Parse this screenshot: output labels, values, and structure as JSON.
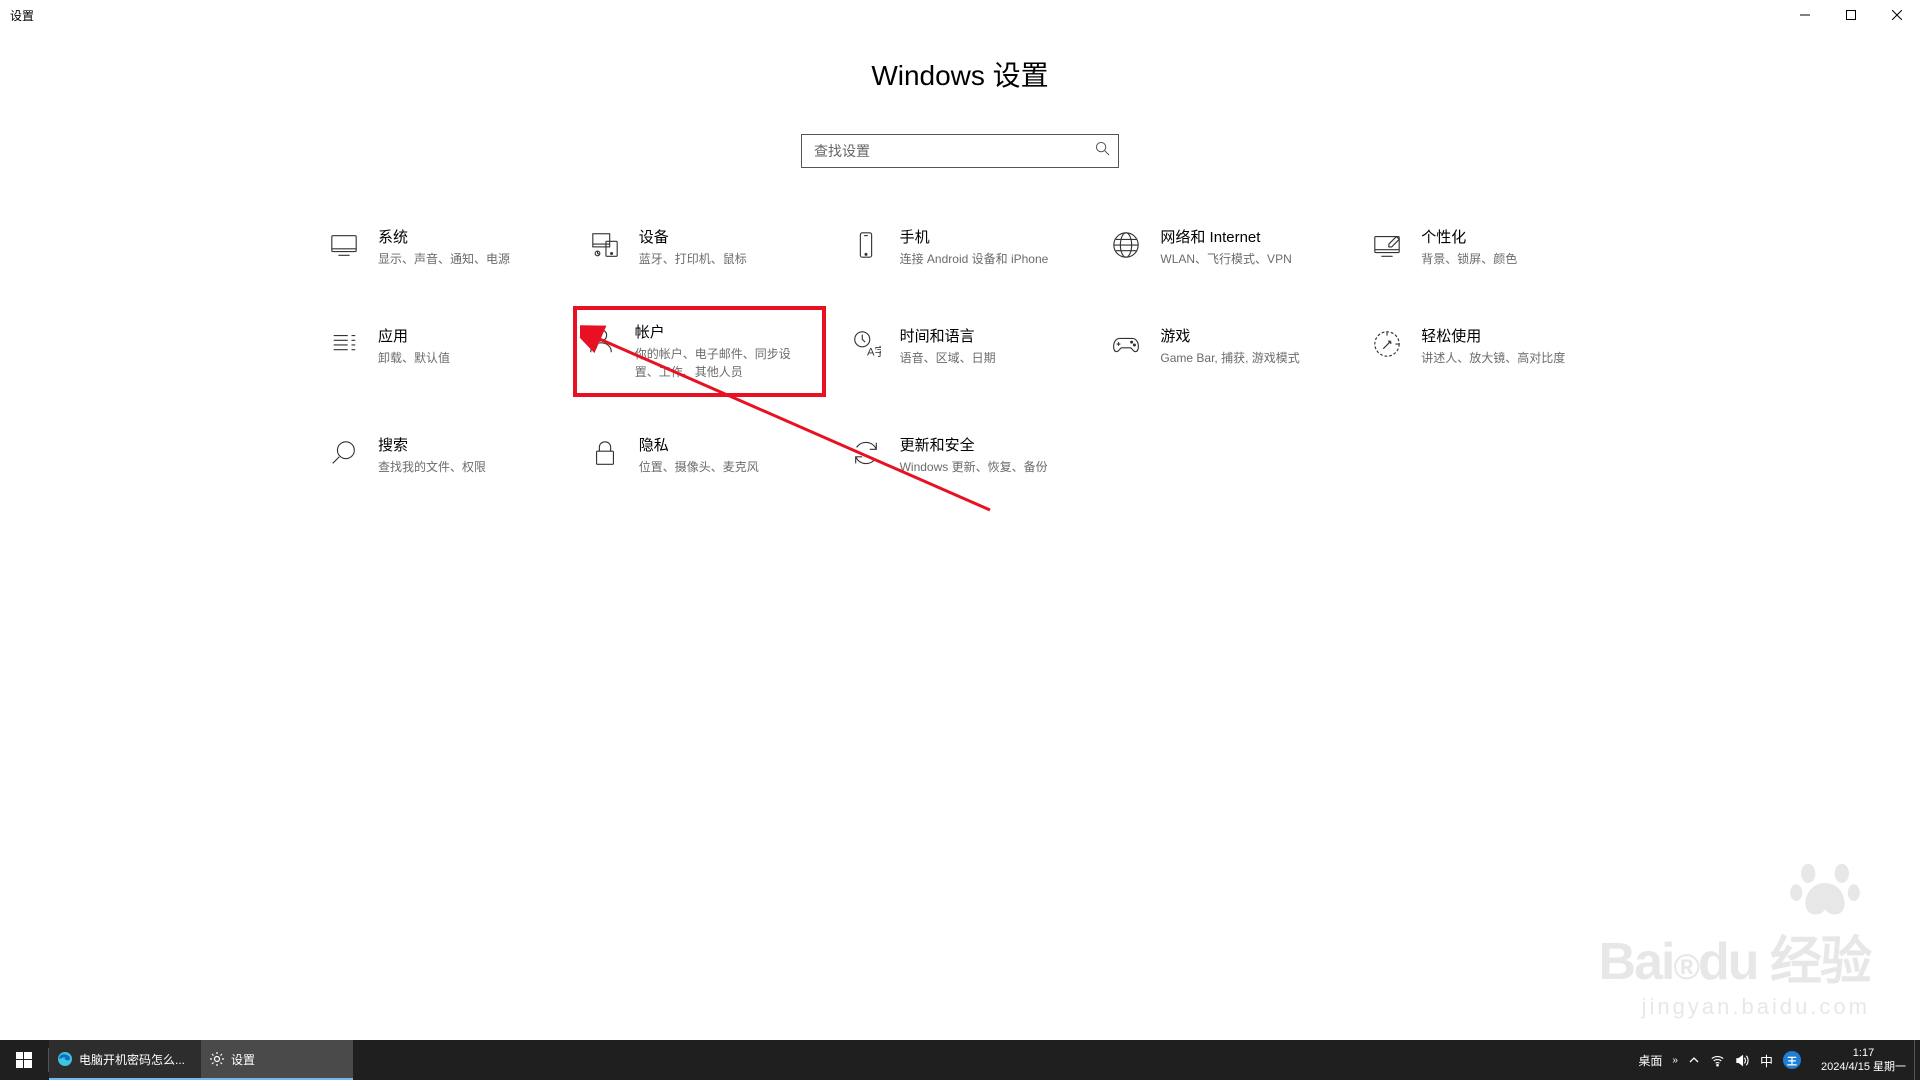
{
  "window": {
    "title": "设置"
  },
  "page": {
    "title": "Windows 设置"
  },
  "search": {
    "placeholder": "查找设置"
  },
  "categories": [
    {
      "title": "系统",
      "desc": "显示、声音、通知、电源"
    },
    {
      "title": "设备",
      "desc": "蓝牙、打印机、鼠标"
    },
    {
      "title": "手机",
      "desc": "连接 Android 设备和 iPhone"
    },
    {
      "title": "网络和 Internet",
      "desc": "WLAN、飞行模式、VPN"
    },
    {
      "title": "个性化",
      "desc": "背景、锁屏、颜色"
    },
    {
      "title": "应用",
      "desc": "卸载、默认值"
    },
    {
      "title": "帐户",
      "desc": "你的帐户、电子邮件、同步设置、工作、其他人员"
    },
    {
      "title": "时间和语言",
      "desc": "语音、区域、日期"
    },
    {
      "title": "游戏",
      "desc": "Game Bar, 捕获, 游戏模式"
    },
    {
      "title": "轻松使用",
      "desc": "讲述人、放大镜、高对比度"
    },
    {
      "title": "搜索",
      "desc": "查找我的文件、权限"
    },
    {
      "title": "隐私",
      "desc": "位置、摄像头、麦克风"
    },
    {
      "title": "更新和安全",
      "desc": "Windows 更新、恢复、备份"
    }
  ],
  "taskbar": {
    "apps": [
      {
        "label": "电脑开机密码怎么...",
        "state": "open"
      },
      {
        "label": "设置",
        "state": "active"
      }
    ],
    "tray": {
      "desktop_label": "桌面",
      "ime": "中",
      "ime2": "王"
    },
    "datetime": {
      "time": "1:17",
      "date": "2024/4/15",
      "weekday": "星期一"
    }
  },
  "watermark": {
    "logo": "Bai",
    "logo2": "du",
    "brand": "经验",
    "url": "jingyan.baidu.com"
  }
}
